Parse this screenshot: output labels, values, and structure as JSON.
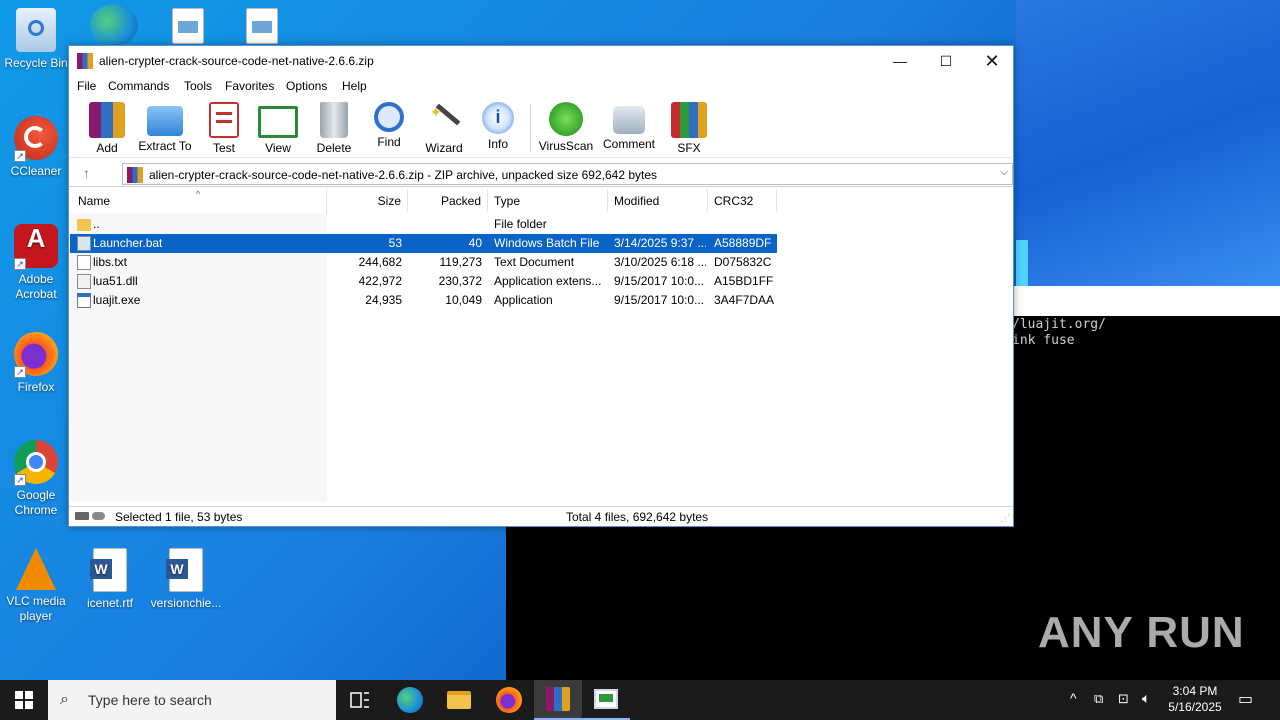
{
  "desktop": {
    "icons": [
      {
        "label": "Recycle Bin"
      },
      {
        "label": "CCleaner"
      },
      {
        "label": "Adobe Acrobat"
      },
      {
        "label": "Firefox"
      },
      {
        "label": "Google Chrome"
      },
      {
        "label": "VLC media player"
      },
      {
        "label": "icenet.rtf"
      },
      {
        "label": "versionchie..."
      }
    ],
    "console_lines": [
      "/luajit.org/",
      "ink fuse"
    ],
    "watermark": "ANY RUN"
  },
  "window": {
    "title": "alien-crypter-crack-source-code-net-native-2.6.6.zip",
    "menu": [
      "File",
      "Commands",
      "Tools",
      "Favorites",
      "Options",
      "Help"
    ],
    "toolbar": [
      "Add",
      "Extract To",
      "Test",
      "View",
      "Delete",
      "Find",
      "Wizard",
      "Info",
      "VirusScan",
      "Comment",
      "SFX"
    ],
    "address": "alien-crypter-crack-source-code-net-native-2.6.6.zip - ZIP archive, unpacked size 692,642 bytes",
    "columns": [
      "Name",
      "Size",
      "Packed",
      "Type",
      "Modified",
      "CRC32"
    ],
    "rows": [
      {
        "name": "..",
        "size": "",
        "packed": "",
        "type": "File folder",
        "modified": "",
        "crc": ""
      },
      {
        "name": "Launcher.bat",
        "size": "53",
        "packed": "40",
        "type": "Windows Batch File",
        "modified": "3/14/2025 9:37 ...",
        "crc": "A58889DF"
      },
      {
        "name": "libs.txt",
        "size": "244,682",
        "packed": "119,273",
        "type": "Text Document",
        "modified": "3/10/2025 6:18 ...",
        "crc": "D075832C"
      },
      {
        "name": "lua51.dll",
        "size": "422,972",
        "packed": "230,372",
        "type": "Application extens...",
        "modified": "9/15/2017 10:0...",
        "crc": "A15BD1FF"
      },
      {
        "name": "luajit.exe",
        "size": "24,935",
        "packed": "10,049",
        "type": "Application",
        "modified": "9/15/2017 10:0...",
        "crc": "3A4F7DAA"
      }
    ],
    "status_left": "Selected 1 file, 53 bytes",
    "status_right": "Total 4 files, 692,642 bytes"
  },
  "taskbar": {
    "search_placeholder": "Type here to search",
    "time": "3:04 PM",
    "date": "5/16/2025"
  }
}
